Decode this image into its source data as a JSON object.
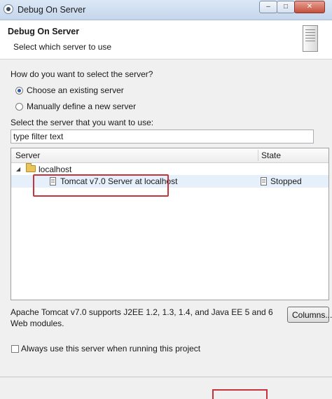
{
  "window": {
    "title": "Debug On Server",
    "min_label": "–",
    "max_label": "□",
    "close_label": "✕"
  },
  "banner": {
    "title": "Debug On Server",
    "subtitle": "Select which server to use"
  },
  "selection": {
    "question": "How do you want to select the server?",
    "options": [
      {
        "label": "Choose an existing server",
        "checked": true
      },
      {
        "label": "Manually define a new server",
        "checked": false
      }
    ]
  },
  "filter": {
    "label": "Select the server that you want to use:",
    "value": "type filter text"
  },
  "table": {
    "columns": [
      "Server",
      "State"
    ],
    "group": {
      "label": "localhost",
      "expanded": true
    },
    "rows": [
      {
        "name": "Tomcat v7.0 Server at localhost",
        "state": "Stopped"
      }
    ]
  },
  "description": "Apache Tomcat v7.0 supports J2EE 1.2, 1.3, 1.4, and Java EE 5 and 6 Web modules.",
  "columns_button": "Columns...",
  "always_use": {
    "label": "Always use this server when running this project",
    "checked": false
  },
  "colors": {
    "highlight": "#c7333a",
    "selection_bg": "#e6f0fb"
  },
  "icons": [
    "app-icon",
    "server-banner-icon",
    "folder-icon",
    "server-icon",
    "state-icon"
  ]
}
